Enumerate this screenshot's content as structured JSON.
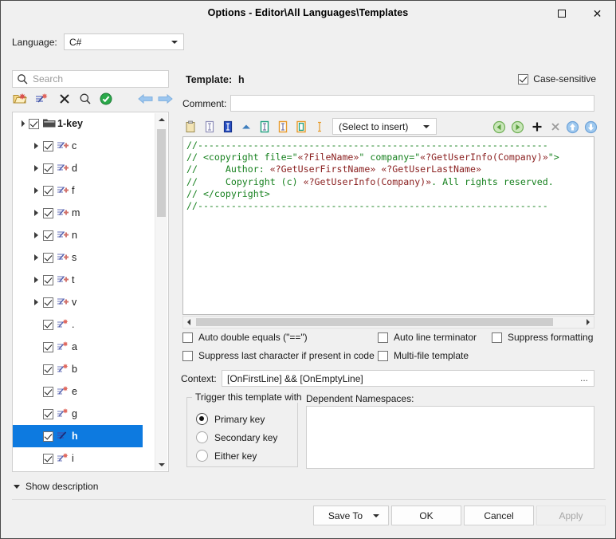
{
  "window": {
    "title": "Options - Editor\\All Languages\\Templates",
    "maximize_icon": "maximize-icon",
    "close_icon": "close-icon"
  },
  "language_row": {
    "label": "Language:",
    "value": "C#"
  },
  "left_panel": {
    "search": {
      "placeholder": "Search",
      "icon": "search-icon"
    },
    "toolbar": [
      {
        "name": "new-folder-icon",
        "title": "New Folder"
      },
      {
        "name": "new-template-icon",
        "title": "New Template"
      },
      {
        "name": "delete-icon",
        "title": "Delete"
      },
      {
        "name": "find-icon",
        "title": "Find"
      },
      {
        "name": "apply-check-icon",
        "title": "Enable"
      },
      {
        "name": "move-left-icon",
        "title": "Move Left"
      },
      {
        "name": "move-right-icon",
        "title": "Move Right"
      }
    ],
    "tree": [
      {
        "label": "1-key",
        "level": 0,
        "expander": "open",
        "checked": true,
        "icon": "folder-icon",
        "selected": false,
        "bold": true
      },
      {
        "label": "c",
        "level": 1,
        "expander": "collapsed",
        "checked": true,
        "icon": "template-group-icon",
        "selected": false,
        "bold": false
      },
      {
        "label": "d",
        "level": 1,
        "expander": "collapsed",
        "checked": true,
        "icon": "template-group-icon",
        "selected": false,
        "bold": false
      },
      {
        "label": "f",
        "level": 1,
        "expander": "collapsed",
        "checked": true,
        "icon": "template-group-icon",
        "selected": false,
        "bold": false
      },
      {
        "label": "m",
        "level": 1,
        "expander": "collapsed",
        "checked": true,
        "icon": "template-group-icon",
        "selected": false,
        "bold": false
      },
      {
        "label": "n",
        "level": 1,
        "expander": "collapsed",
        "checked": true,
        "icon": "template-group-icon",
        "selected": false,
        "bold": false
      },
      {
        "label": "s",
        "level": 1,
        "expander": "collapsed",
        "checked": true,
        "icon": "template-group-icon",
        "selected": false,
        "bold": false
      },
      {
        "label": "t",
        "level": 1,
        "expander": "collapsed",
        "checked": true,
        "icon": "template-group-icon",
        "selected": false,
        "bold": false
      },
      {
        "label": "v",
        "level": 1,
        "expander": "collapsed",
        "checked": true,
        "icon": "template-group-icon",
        "selected": false,
        "bold": false
      },
      {
        "label": ".",
        "level": 1,
        "expander": "none",
        "checked": true,
        "icon": "template-icon",
        "selected": false,
        "bold": false
      },
      {
        "label": "a",
        "level": 1,
        "expander": "none",
        "checked": true,
        "icon": "template-icon",
        "selected": false,
        "bold": false
      },
      {
        "label": "b",
        "level": 1,
        "expander": "none",
        "checked": true,
        "icon": "template-icon",
        "selected": false,
        "bold": false
      },
      {
        "label": "e",
        "level": 1,
        "expander": "none",
        "checked": true,
        "icon": "template-icon",
        "selected": false,
        "bold": false
      },
      {
        "label": "g",
        "level": 1,
        "expander": "none",
        "checked": true,
        "icon": "template-icon",
        "selected": false,
        "bold": false
      },
      {
        "label": "h",
        "level": 1,
        "expander": "none",
        "checked": true,
        "icon": "template-icon-selected",
        "selected": true,
        "bold": true
      },
      {
        "label": "i",
        "level": 1,
        "expander": "none",
        "checked": true,
        "icon": "template-icon",
        "selected": false,
        "bold": false
      }
    ],
    "show_description": "Show description"
  },
  "right_panel": {
    "template_label": "Template:",
    "template_value": "h",
    "case_sensitive": {
      "label": "Case-sensitive",
      "checked": true
    },
    "comment_label": "Comment:",
    "comment_value": "",
    "editor_toolbar": {
      "icons": [
        {
          "name": "clipboard-icon"
        },
        {
          "name": "insert-variable-icon"
        },
        {
          "name": "insert-variable-filled-icon"
        },
        {
          "name": "collapse-up-icon"
        },
        {
          "name": "green-field-icon"
        },
        {
          "name": "orange-field-icon"
        },
        {
          "name": "orange-green-field-icon"
        },
        {
          "name": "caret-marker-icon"
        }
      ],
      "insert_dropdown": "(Select to insert)",
      "right_icons": [
        {
          "name": "previous-hotspot-icon"
        },
        {
          "name": "next-hotspot-icon"
        },
        {
          "name": "add-variable-icon"
        },
        {
          "name": "remove-variable-icon"
        },
        {
          "name": "move-up-icon"
        },
        {
          "name": "move-down-icon"
        }
      ]
    },
    "code_lines": [
      [
        {
          "t": "//---------------------------------------------------------------",
          "c": "green"
        }
      ],
      [
        {
          "t": "// <copyright file=\"",
          "c": "green"
        },
        {
          "t": "«?FileName»",
          "c": "ph"
        },
        {
          "t": "\" company=\"",
          "c": "green"
        },
        {
          "t": "«?GetUserInfo(Company)»",
          "c": "ph"
        },
        {
          "t": "\">",
          "c": "green"
        }
      ],
      [
        {
          "t": "//     Author: ",
          "c": "green"
        },
        {
          "t": "«?GetUserFirstName»",
          "c": "ph"
        },
        {
          "t": " ",
          "c": "green"
        },
        {
          "t": "«?GetUserLastName»",
          "c": "ph"
        }
      ],
      [
        {
          "t": "//     Copyright (c) ",
          "c": "green"
        },
        {
          "t": "«?GetUserInfo(Company)»",
          "c": "ph"
        },
        {
          "t": ". All rights reserved.",
          "c": "green"
        }
      ],
      [
        {
          "t": "// </copyright>",
          "c": "green"
        }
      ],
      [
        {
          "t": "//---------------------------------------------------------------",
          "c": "green"
        }
      ]
    ],
    "options": [
      {
        "label": "Auto double equals (\"==\")",
        "checked": false
      },
      {
        "label": "Auto line terminator",
        "checked": false
      },
      {
        "label": "Suppress formatting",
        "checked": false
      },
      {
        "label": "Suppress last character if present in code",
        "checked": false
      },
      {
        "label": "Multi-file template",
        "checked": false
      }
    ],
    "context": {
      "label": "Context:",
      "value": "[OnFirstLine] && [OnEmptyLine]",
      "browse": "..."
    },
    "trigger_group": {
      "title": "Trigger this template with",
      "options": [
        {
          "label": "Primary key",
          "selected": true
        },
        {
          "label": "Secondary key",
          "selected": false
        },
        {
          "label": "Either key",
          "selected": false
        }
      ]
    },
    "dependent_namespaces": {
      "title": "Dependent Namespaces:",
      "value": ""
    }
  },
  "footer": {
    "save_to": "Save To",
    "ok": "OK",
    "cancel": "Cancel",
    "apply": "Apply",
    "apply_disabled": true
  },
  "colors": {
    "selection": "#0d7ae0",
    "code_comment": "#17811f",
    "code_placeholder": "#8a1f1f",
    "dialog_bg": "#f0f0f0"
  }
}
